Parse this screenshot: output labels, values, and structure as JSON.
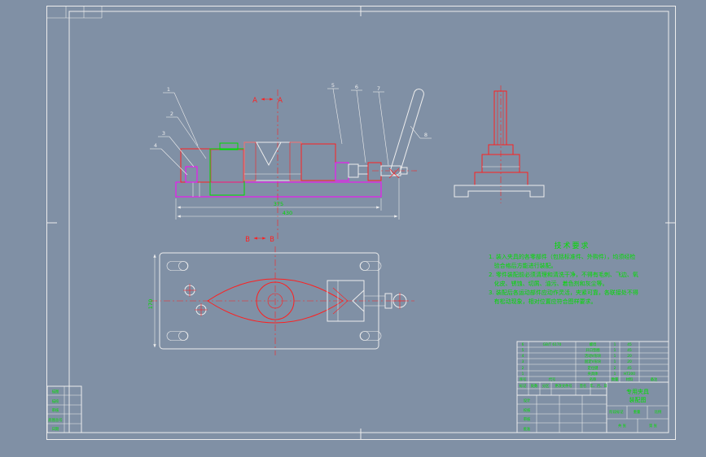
{
  "palette": {
    "canvas_bg": "#8090a5",
    "sheet_bg": "#000000",
    "frame_line": "#ededed",
    "line_red": "#ff1f1f",
    "line_green": "#00dd00",
    "line_magenta": "#ff00ff",
    "hatch_blue": "#4444ff"
  },
  "front_view": {
    "section_left": "A",
    "section_right": "A",
    "balloons": [
      "1",
      "2",
      "3",
      "4",
      "5",
      "6",
      "7",
      "8"
    ],
    "dim_width": "375",
    "dim_total": "430"
  },
  "plan_view": {
    "section_left": "B",
    "section_right": "B",
    "dim_height": "170"
  },
  "tech": {
    "title": "技术要求",
    "lines": [
      "1. 装入夹具的各零部件（包括标准件、外购件），均须经检",
      "   验合格后方能进行装配。",
      "2. 零件装配前必须清理和清洗干净，不得有毛刺、飞边、氧",
      "   化皮、锈蚀、切屑、油污、着色剂和灰尘等。",
      "3. 装配后各运动部件应动作灵活，夹紧可靠，各联接处不得",
      "   有松动现象，相对位置应符合图样要求。"
    ]
  },
  "parts_list": {
    "header": {
      "no": "序号",
      "code": "代号",
      "name": "名称",
      "qty": "数量",
      "mat": "材料",
      "note": "备注"
    },
    "rows": [
      {
        "no": "6",
        "code": "GB/T 6170",
        "name": "螺母",
        "qty": "1",
        "mat": "45"
      },
      {
        "no": "5",
        "code": "",
        "name": "开口垫圈",
        "qty": "1",
        "mat": "45"
      },
      {
        "no": "4",
        "code": "",
        "name": "活动V形块",
        "qty": "1",
        "mat": "20"
      },
      {
        "no": "3",
        "code": "",
        "name": "固定V形块",
        "qty": "1",
        "mat": "20"
      },
      {
        "no": "2",
        "code": "",
        "name": "定位键",
        "qty": "2",
        "mat": "45"
      },
      {
        "no": "1",
        "code": "",
        "name": "夹具体",
        "qty": "1",
        "mat": "HT200"
      }
    ]
  },
  "title_block": {
    "mark": "标记",
    "count": "处数",
    "zone": "分区",
    "file": "更改文件号",
    "sign": "签名",
    "date": "年、月、日",
    "design": "设计",
    "check": "校核",
    "review": "审核",
    "approve": "批准",
    "stage": "阶段标记",
    "weight": "重量",
    "scale": "比例",
    "sheets": "共 张",
    "sheet_no": "第 张",
    "title_line1": "专用夹具",
    "title_line2": "装配图"
  },
  "left_strip": {
    "rows": [
      "描图",
      "描校",
      "审核",
      "底图总号",
      "日期"
    ]
  }
}
